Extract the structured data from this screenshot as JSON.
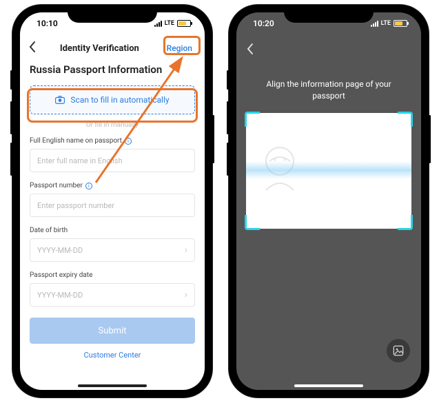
{
  "left": {
    "status_time": "10:10",
    "lte": "LTE",
    "nav": {
      "title": "Identity Verification",
      "region_label": "Region"
    },
    "page_title": "Russia Passport Information",
    "scan_label": "Scan to fill in automatically",
    "or_label": "Or fill in manually",
    "fields": {
      "name_label": "Full English name on passport",
      "name_placeholder": "Enter full name in English",
      "num_label": "Passport number",
      "num_placeholder": "Enter passport number",
      "dob_label": "Date of birth",
      "dob_placeholder": "YYYY-MM-DD",
      "exp_label": "Passport expiry date",
      "exp_placeholder": "YYYY-MM-DD"
    },
    "submit_label": "Submit",
    "customer_center": "Customer Center"
  },
  "right": {
    "status_time": "10:20",
    "lte": "LTE",
    "instruction": "Align the information page of your passport"
  },
  "colors": {
    "highlight": "#e8742c",
    "primary": "#2b7de0",
    "scan_corner": "#29d3e8"
  }
}
